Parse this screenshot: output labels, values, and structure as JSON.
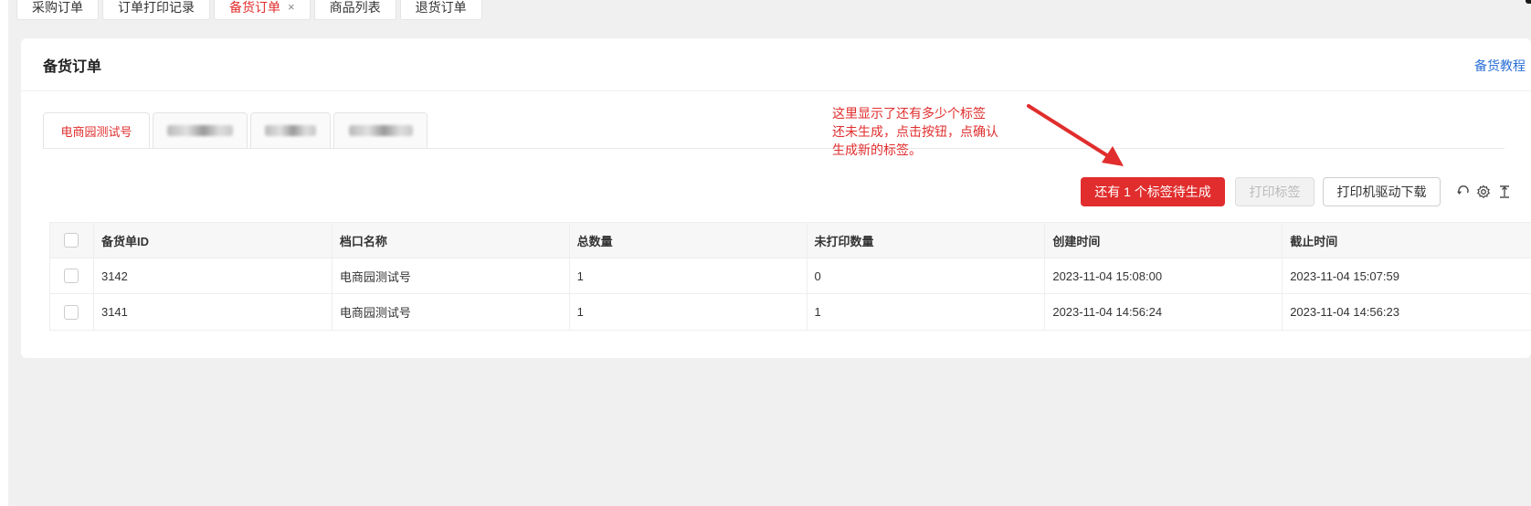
{
  "top_tabs": [
    {
      "label": "采购订单"
    },
    {
      "label": "订单打印记录"
    },
    {
      "label": "备货订单",
      "close": "×"
    },
    {
      "label": "商品列表"
    },
    {
      "label": "退货订单"
    }
  ],
  "card": {
    "title": "备货订单",
    "help_link": "备货教程"
  },
  "shop_tabs": [
    {
      "label": "电商园测试号"
    }
  ],
  "annotation": {
    "lines": [
      "这里显示了还有多少个标签",
      "还未生成，点击按钮，点确认",
      "生成新的标签。"
    ]
  },
  "toolbar": {
    "generate_label": "还有 1 个标签待生成",
    "print_label": "打印标签",
    "driver_label": "打印机驱动下载",
    "icons": [
      "refresh-icon",
      "gear-icon",
      "column-height-icon"
    ]
  },
  "table": {
    "columns": [
      "备货单ID",
      "档口名称",
      "总数量",
      "未打印数量",
      "创建时间",
      "截止时间"
    ],
    "rows": [
      [
        "3142",
        "电商园测试号",
        "1",
        "0",
        "2023-11-04 15:08:00",
        "2023-11-04 15:07:59"
      ],
      [
        "3141",
        "电商园测试号",
        "1",
        "1",
        "2023-11-04 14:56:24",
        "2023-11-04 14:56:23"
      ]
    ]
  },
  "colors": {
    "accent": "#e12d2d",
    "link": "#2b6fd6"
  }
}
